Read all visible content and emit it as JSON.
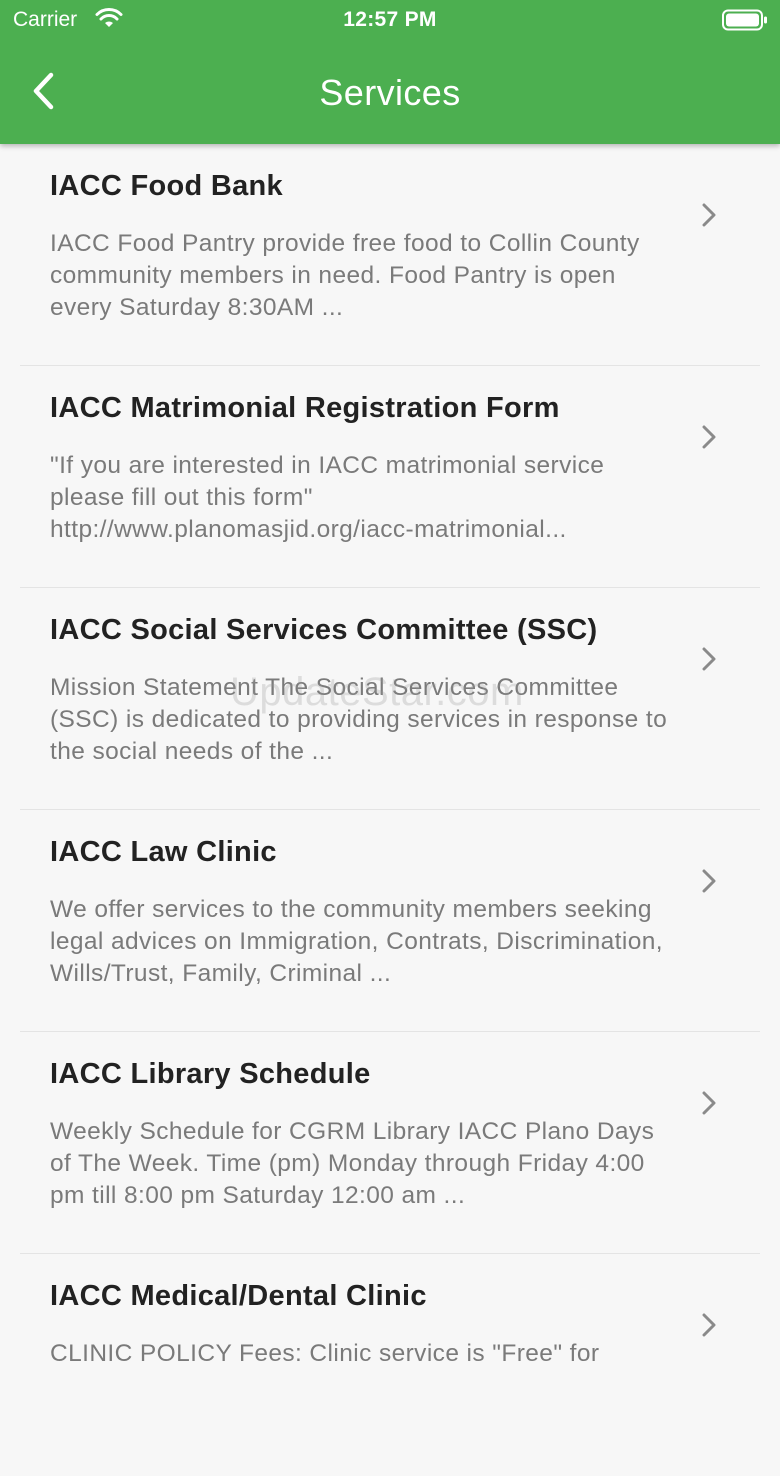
{
  "status_bar": {
    "carrier": "Carrier",
    "time": "12:57 PM",
    "wifi_icon": "wifi-icon",
    "battery_icon": "battery-icon"
  },
  "nav": {
    "title": "Services",
    "back_icon": "chevron-left-icon"
  },
  "colors": {
    "header": "#4caf50",
    "background": "#f7f7f7",
    "title_text": "#222222",
    "desc_text": "#7a7a7a"
  },
  "services": [
    {
      "title": "IACC Food Bank",
      "description": "IACC Food Pantry provide free food to Collin County community members in need. Food Pantry is open every Saturday 8:30AM ..."
    },
    {
      "title": "IACC Matrimonial Registration Form",
      "description": "\"If you are interested in IACC matrimonial service please fill out this form\" http://www.planomasjid.org/iacc-matrimonial..."
    },
    {
      "title": "IACC Social Services Committee (SSC)",
      "description": "Mission Statement The Social Services Committee (SSC) is dedicated to providing services in response to the social needs of the ..."
    },
    {
      "title": "IACC Law Clinic",
      "description": "We offer services to the community members seeking legal advices on Immigration, Contrats, Discrimination, Wills/Trust, Family, Criminal ..."
    },
    {
      "title": "IACC Library Schedule",
      "description": "Weekly Schedule for CGRM Library IACC Plano Days of The Week. Time (pm) Monday through Friday 4:00 pm till 8:00 pm Saturday 12:00 am ..."
    },
    {
      "title": "IACC Medical/Dental Clinic",
      "description": "CLINIC POLICY Fees: Clinic service is \"Free\" for"
    }
  ],
  "watermark": "UpdateStar.com"
}
